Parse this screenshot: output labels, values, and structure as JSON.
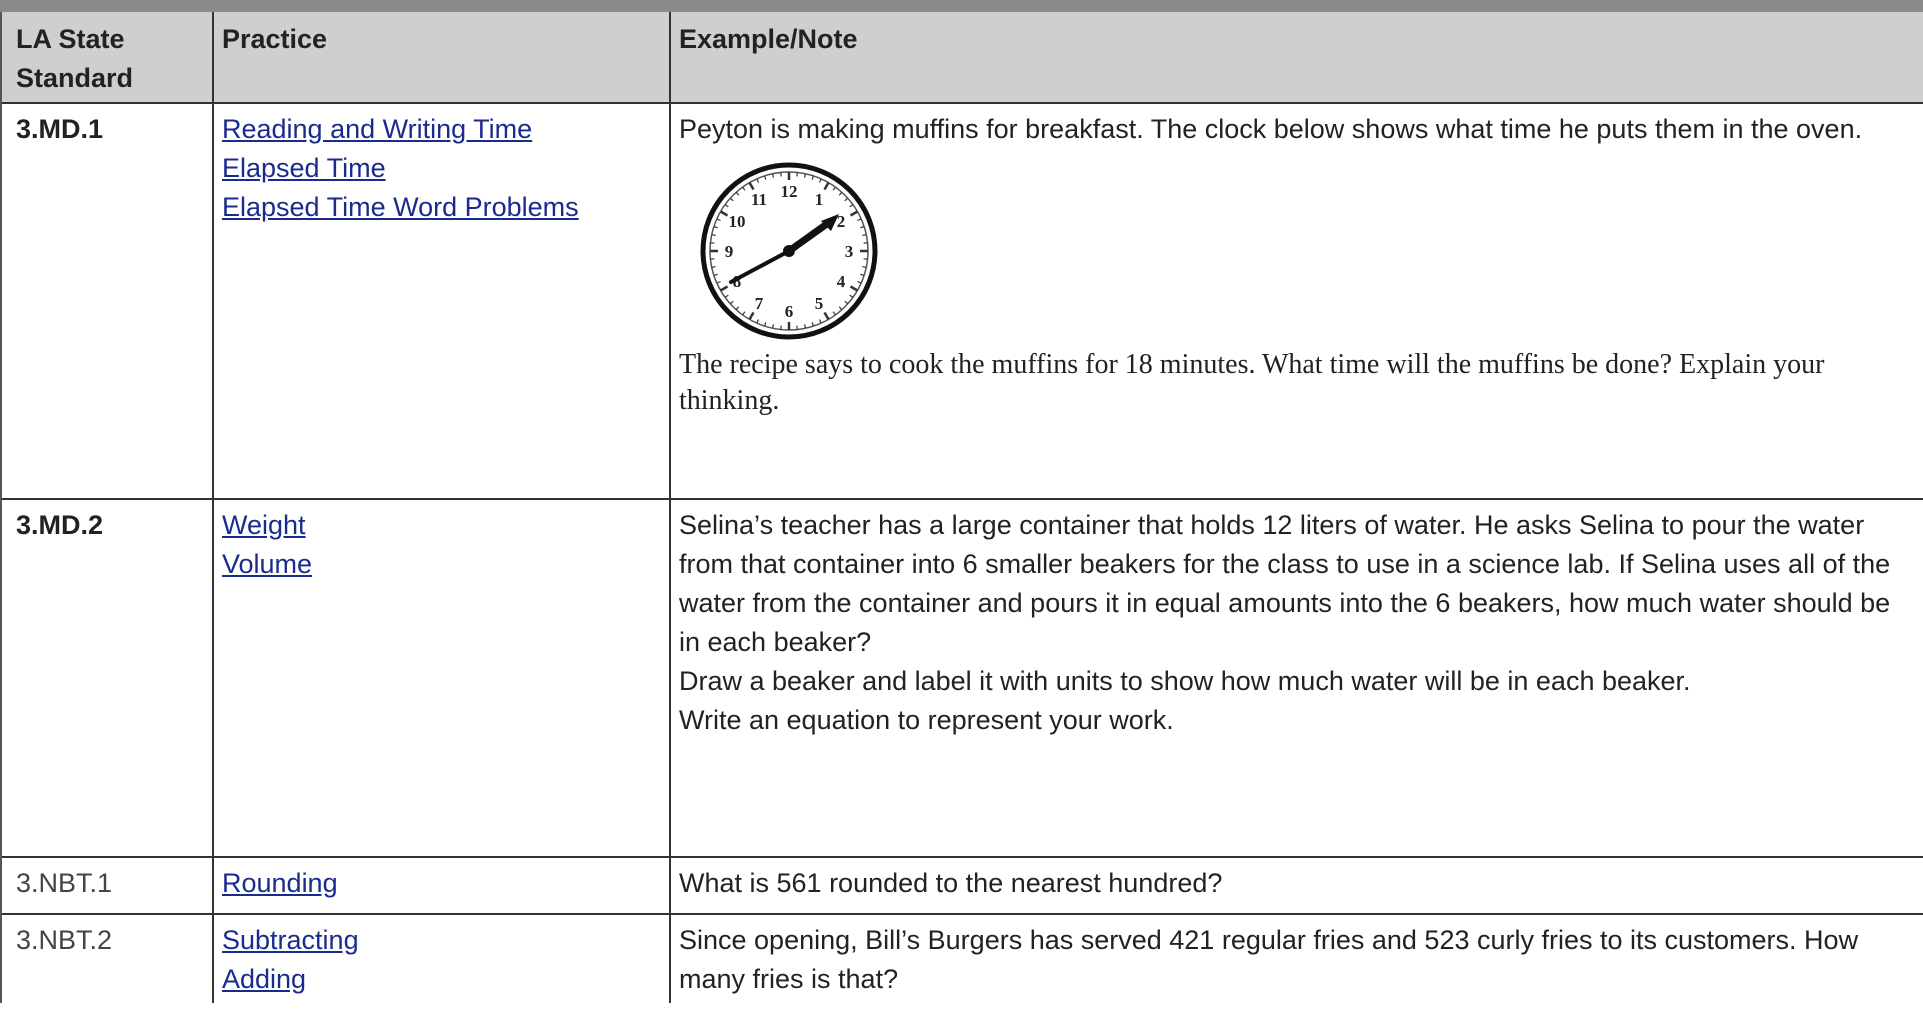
{
  "headers": {
    "standard": "LA State Standard",
    "practice": "Practice",
    "example": "Example/Note"
  },
  "rows": [
    {
      "standard": "3.MD.1",
      "links": [
        "Reading and Writing Time",
        "Elapsed Time",
        "Elapsed Time Word Problems"
      ],
      "example_intro": "Peyton is making muffins for breakfast. The clock below shows what time he puts them in the oven.",
      "clock_numbers": [
        "12",
        "1",
        "2",
        "3",
        "4",
        "5",
        "6",
        "7",
        "8",
        "9",
        "10",
        "11"
      ],
      "example_after": "The recipe says to cook the muffins for 18 minutes. What time will the muffins be done? Explain your thinking."
    },
    {
      "standard": "3.MD.2",
      "links": [
        "Weight",
        "Volume"
      ],
      "paragraphs": [
        " Selina’s teacher has a large container that holds 12 liters of water. He asks Selina to pour the water from that container into 6 smaller beakers for the class to use in a science lab. If Selina uses all of the water from the container and pours it in equal amounts into the 6 beakers, how much water should be in each beaker?",
        "Draw a beaker and label it with units to show how much water will be in each beaker.",
        "Write an equation to represent your work."
      ]
    },
    {
      "standard": "3.NBT.1",
      "links": [
        "Rounding"
      ],
      "example": "What is 561 rounded to the nearest hundred?"
    },
    {
      "standard": "3.NBT.2",
      "links": [
        "Subtracting",
        "Adding"
      ],
      "example": "Since opening, Bill’s Burgers has served 421 regular fries and 523 curly fries to its customers. How many fries is that?"
    }
  ],
  "colors": {
    "header_bg": "#cfcfcf",
    "top_bar": "#8a8a8a",
    "link": "#1a2a8f"
  }
}
